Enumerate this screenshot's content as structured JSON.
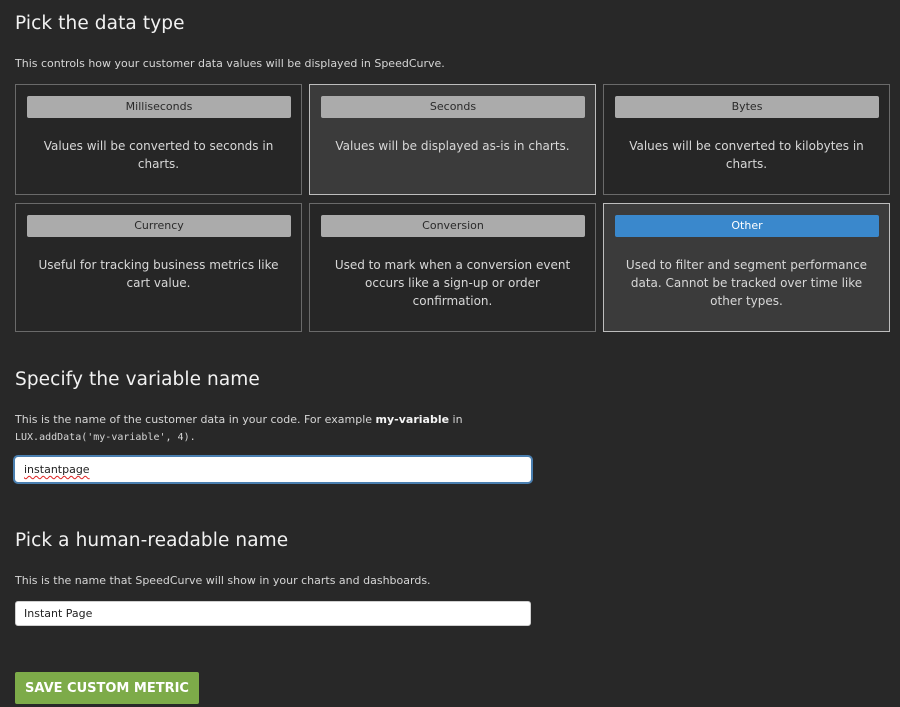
{
  "data_type_section": {
    "title": "Pick the data type",
    "description": "This controls how your customer data values will be displayed in SpeedCurve.",
    "options": [
      {
        "label": "Milliseconds",
        "description": "Values will be converted to seconds in charts."
      },
      {
        "label": "Seconds",
        "description": "Values will be displayed as-is in charts."
      },
      {
        "label": "Bytes",
        "description": "Values will be converted to kilobytes in charts."
      },
      {
        "label": "Currency",
        "description": "Useful for tracking business metrics like cart value."
      },
      {
        "label": "Conversion",
        "description": "Used to mark when a conversion event occurs like a sign-up or order confirmation."
      },
      {
        "label": "Other",
        "description": "Used to filter and segment performance data. Cannot be tracked over time like other types."
      }
    ],
    "selected_option": "Other",
    "highlighted_option": "Seconds"
  },
  "variable_section": {
    "title": "Specify the variable name",
    "description_prefix": "This is the name of the customer data in your code. For example",
    "example_variable": "my-variable",
    "description_suffix": "in",
    "code_example": "LUX.addData('my-variable', 4).",
    "input_value": "instantpage"
  },
  "human_name_section": {
    "title": "Pick a human-readable name",
    "description": "This is the name that SpeedCurve will show in your charts and dashboards.",
    "input_value": "Instant Page"
  },
  "save_button_label": "SAVE CUSTOM METRIC",
  "colors": {
    "background": "#282828",
    "selected_pill": "#3a88cc",
    "save_button": "#7dab49"
  }
}
